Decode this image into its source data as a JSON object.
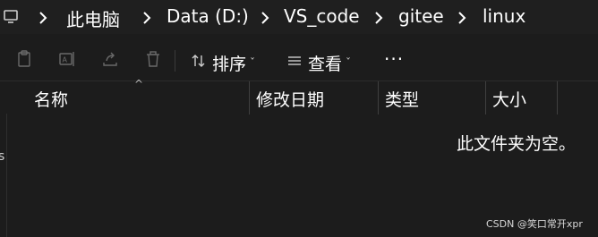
{
  "breadcrumb": {
    "items": [
      "此电脑",
      "Data (D:)",
      "VS_code",
      "gitee",
      "linux"
    ]
  },
  "toolbar": {
    "sort_label": "排序",
    "view_label": "查看",
    "more_label": "···"
  },
  "columns": [
    "名称",
    "修改日期",
    "类型",
    "大小"
  ],
  "empty_message": "此文件夹为空。",
  "left_rail_char": "s",
  "watermark": "CSDN @笑口常开xpr",
  "colors": {
    "background": "#1c1c1c",
    "text": "#ffffff",
    "icon": "#8a8a8a"
  }
}
